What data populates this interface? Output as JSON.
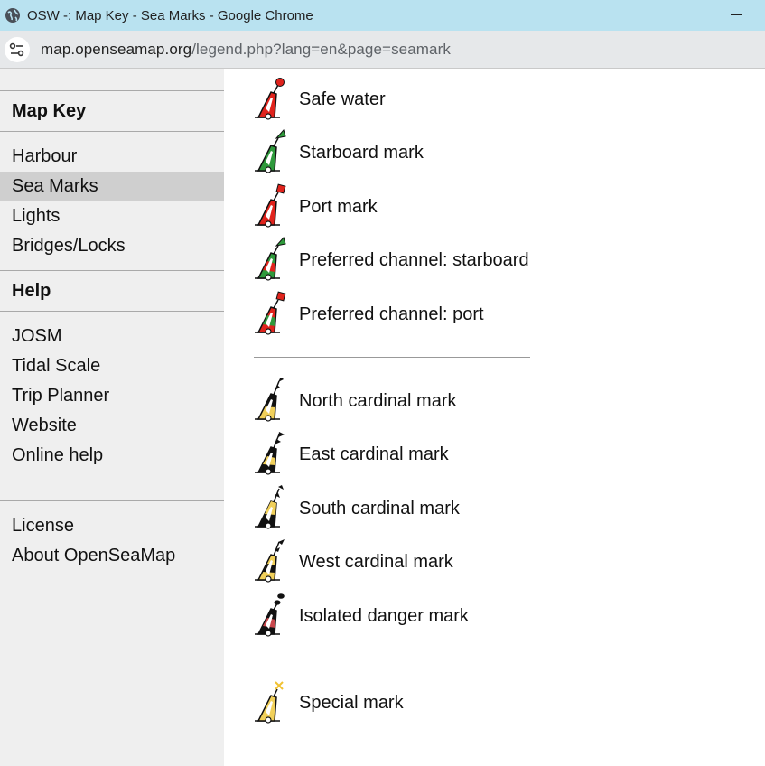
{
  "window": {
    "title": "OSW -: Map Key - Sea Marks - Google Chrome",
    "globe_icon": "globe-icon",
    "minimize_icon": "minimize-icon"
  },
  "address_bar": {
    "site_info_icon": "tune-icon",
    "url_host": "map.openseamap.org",
    "url_path": "/legend.php?lang=en&page=seamark"
  },
  "sidebar": {
    "map_key_heading": "Map Key",
    "map_items": [
      {
        "label": "Harbour",
        "active": false
      },
      {
        "label": "Sea Marks",
        "active": true
      },
      {
        "label": "Lights",
        "active": false
      },
      {
        "label": "Bridges/Locks",
        "active": false
      }
    ],
    "help_heading": "Help",
    "help_items": [
      {
        "label": "JOSM"
      },
      {
        "label": "Tidal Scale"
      },
      {
        "label": "Trip Planner"
      },
      {
        "label": "Website"
      },
      {
        "label": "Online help"
      }
    ],
    "bottom_items": [
      {
        "label": "License"
      },
      {
        "label": "About OpenSeaMap"
      }
    ]
  },
  "marks": [
    {
      "label": "Safe water",
      "icon": "safe-water-buoy-icon"
    },
    {
      "label": "Starboard mark",
      "icon": "starboard-buoy-icon"
    },
    {
      "label": "Port mark",
      "icon": "port-buoy-icon"
    },
    {
      "label": "Preferred channel: starboard",
      "icon": "preferred-channel-starboard-buoy-icon"
    },
    {
      "label": "Preferred channel: port",
      "icon": "preferred-channel-port-buoy-icon"
    },
    {
      "label": "North cardinal mark",
      "icon": "north-cardinal-buoy-icon"
    },
    {
      "label": "East cardinal mark",
      "icon": "east-cardinal-buoy-icon"
    },
    {
      "label": "South cardinal mark",
      "icon": "south-cardinal-buoy-icon"
    },
    {
      "label": "West cardinal mark",
      "icon": "west-cardinal-buoy-icon"
    },
    {
      "label": "Isolated danger mark",
      "icon": "isolated-danger-buoy-icon"
    },
    {
      "label": "Special mark",
      "icon": "special-mark-buoy-icon"
    }
  ],
  "colors": {
    "title_bar": "#b9e2f0",
    "sidebar_bg": "#efefef",
    "sidebar_active": "#cfcfcf",
    "red": "#e0231c",
    "green": "#2f9a3c",
    "yellow": "#f1d05a",
    "black": "#111111"
  }
}
